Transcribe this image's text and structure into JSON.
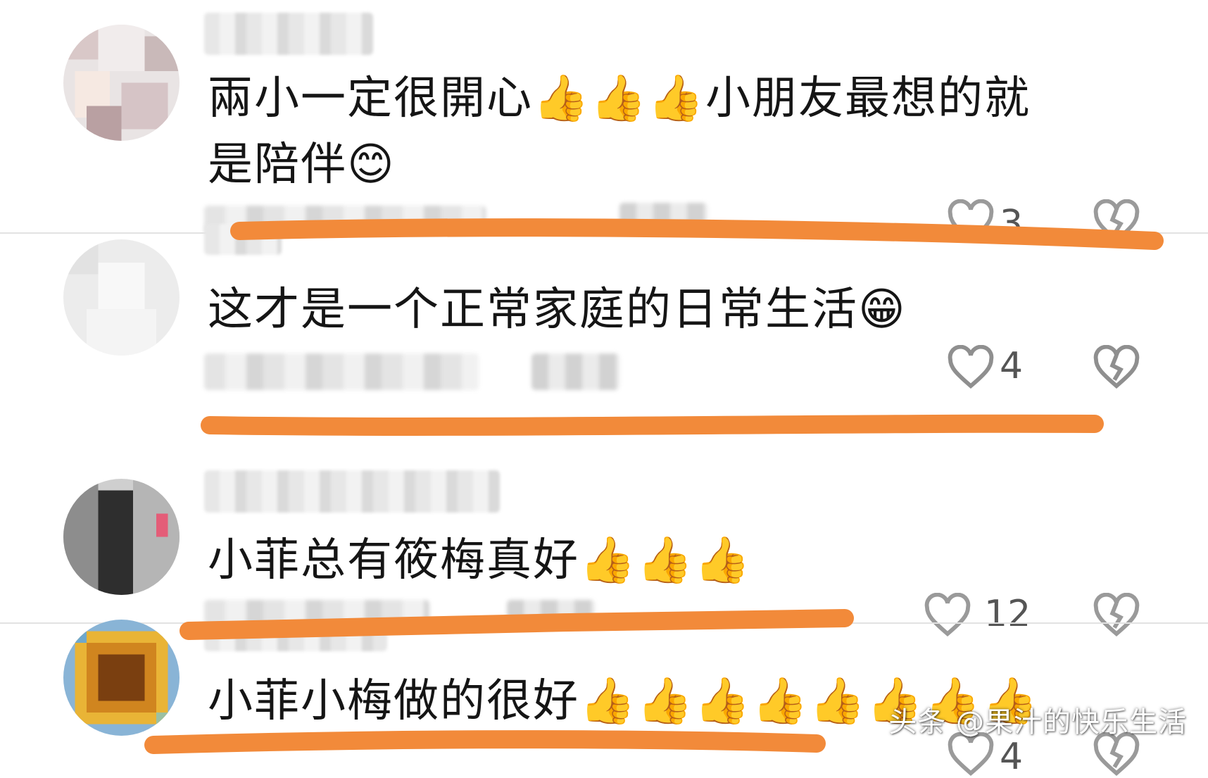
{
  "comments": [
    {
      "text": "兩小一定很開心👍👍👍小朋友最想的就",
      "text_line2": "是陪伴😊",
      "likes": "3"
    },
    {
      "text": "这才是一个正常家庭的日常生活😁",
      "likes": "4"
    },
    {
      "text": "小菲总有筱梅真好👍👍👍",
      "likes": "12"
    },
    {
      "text": "小菲小梅做的很好👍👍👍👍👍👍👍👍",
      "likes": "4"
    }
  ],
  "watermark": "头条 @果汁的快乐生活",
  "icons": [
    "heart-outline-icon",
    "broken-heart-icon"
  ],
  "colors": {
    "underline": "#f28a3a",
    "divider": "#e2e2e2"
  }
}
